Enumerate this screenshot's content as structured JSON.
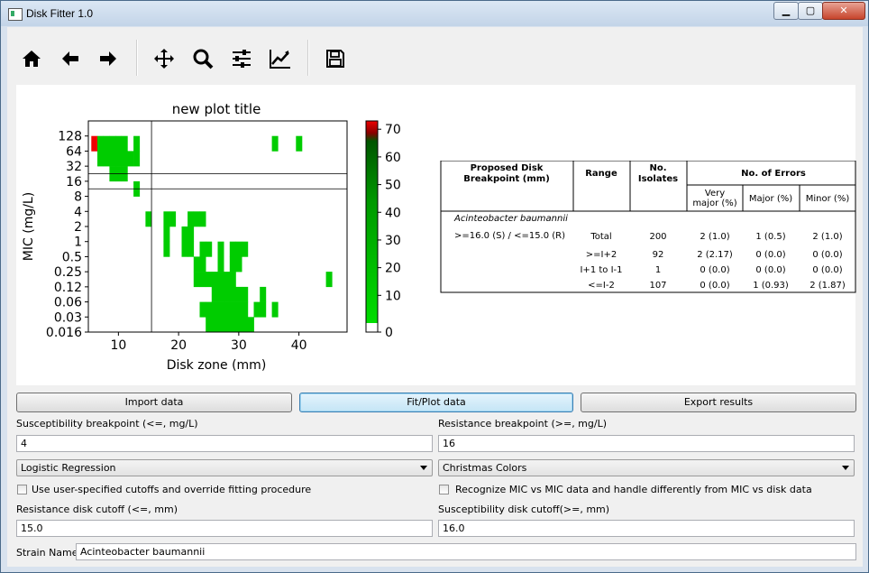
{
  "window": {
    "title": "Disk Fitter 1.0",
    "min_icon": "minimize-icon",
    "max_icon": "maximize-icon",
    "close_icon": "close-icon"
  },
  "toolbar": {
    "icons": [
      "home-icon",
      "back-arrow-icon",
      "forward-arrow-icon",
      "pan-icon",
      "zoom-icon",
      "configure-subplots-icon",
      "edit-axis-icon",
      "save-icon"
    ]
  },
  "plot": {
    "title": "new plot title",
    "xlabel": "Disk zone (mm)",
    "ylabel": "MIC (mg/L)",
    "ytick_labels": [
      "0.016",
      "0.03",
      "0.06",
      "0.12",
      "0.25",
      "0.5",
      "1",
      "2",
      "4",
      "8",
      "16",
      "32",
      "64",
      "128"
    ],
    "xtick_labels": [
      "10",
      "20",
      "30",
      "40"
    ],
    "colorbar_ticks": [
      "0",
      "10",
      "20",
      "30",
      "40",
      "50",
      "60",
      "70"
    ]
  },
  "chart_data": {
    "type": "heatmap",
    "title": "new plot title",
    "xlabel": "Disk zone (mm)",
    "ylabel": "MIC (mg/L)",
    "xlim": [
      5,
      48
    ],
    "y_levels": [
      "0.016",
      "0.03",
      "0.06",
      "0.12",
      "0.25",
      "0.5",
      "1",
      "2",
      "4",
      "8",
      "16",
      "32",
      "64",
      "128"
    ],
    "vlines": [
      16
    ],
    "hlines": [
      8,
      16
    ],
    "colorbar_range": [
      0,
      73
    ],
    "colors": {
      "low": "#00cc00",
      "mid": "#00aa00",
      "high": "#cc0000",
      "max": "#ee0000"
    },
    "cells": [
      {
        "x": 6,
        "y": "64",
        "v": 73
      },
      {
        "x": 7,
        "y": "64",
        "v": 4
      },
      {
        "x": 8,
        "y": "64",
        "v": 4
      },
      {
        "x": 9,
        "y": "64",
        "v": 4
      },
      {
        "x": 10,
        "y": "64",
        "v": 4
      },
      {
        "x": 11,
        "y": "64",
        "v": 4
      },
      {
        "x": 13,
        "y": "64",
        "v": 4
      },
      {
        "x": 7,
        "y": "32",
        "v": 4
      },
      {
        "x": 8,
        "y": "32",
        "v": 4
      },
      {
        "x": 9,
        "y": "32",
        "v": 4
      },
      {
        "x": 10,
        "y": "32",
        "v": 4
      },
      {
        "x": 11,
        "y": "32",
        "v": 4
      },
      {
        "x": 12,
        "y": "32",
        "v": 4
      },
      {
        "x": 13,
        "y": "32",
        "v": 4
      },
      {
        "x": 9,
        "y": "16",
        "v": 4
      },
      {
        "x": 10,
        "y": "16",
        "v": 4
      },
      {
        "x": 11,
        "y": "16",
        "v": 4
      },
      {
        "x": 13,
        "y": "8",
        "v": 4
      },
      {
        "x": 15,
        "y": "2",
        "v": 4
      },
      {
        "x": 18,
        "y": "2",
        "v": 4
      },
      {
        "x": 19,
        "y": "2",
        "v": 4
      },
      {
        "x": 22,
        "y": "2",
        "v": 4
      },
      {
        "x": 23,
        "y": "2",
        "v": 4
      },
      {
        "x": 24,
        "y": "2",
        "v": 4
      },
      {
        "x": 18,
        "y": "1",
        "v": 4
      },
      {
        "x": 21,
        "y": "1",
        "v": 4
      },
      {
        "x": 22,
        "y": "1",
        "v": 4
      },
      {
        "x": 18,
        "y": "0.5",
        "v": 4
      },
      {
        "x": 21,
        "y": "0.5",
        "v": 4
      },
      {
        "x": 22,
        "y": "0.5",
        "v": 4
      },
      {
        "x": 24,
        "y": "0.5",
        "v": 4
      },
      {
        "x": 25,
        "y": "0.5",
        "v": 4
      },
      {
        "x": 27,
        "y": "0.5",
        "v": 4
      },
      {
        "x": 29,
        "y": "0.5",
        "v": 4
      },
      {
        "x": 30,
        "y": "0.5",
        "v": 4
      },
      {
        "x": 31,
        "y": "0.5",
        "v": 4
      },
      {
        "x": 23,
        "y": "0.25",
        "v": 4
      },
      {
        "x": 24,
        "y": "0.25",
        "v": 4
      },
      {
        "x": 27,
        "y": "0.25",
        "v": 4
      },
      {
        "x": 29,
        "y": "0.25",
        "v": 4
      },
      {
        "x": 30,
        "y": "0.25",
        "v": 4
      },
      {
        "x": 23,
        "y": "0.12",
        "v": 4
      },
      {
        "x": 24,
        "y": "0.12",
        "v": 4
      },
      {
        "x": 25,
        "y": "0.12",
        "v": 4
      },
      {
        "x": 26,
        "y": "0.12",
        "v": 4
      },
      {
        "x": 27,
        "y": "0.12",
        "v": 4
      },
      {
        "x": 28,
        "y": "0.12",
        "v": 4
      },
      {
        "x": 29,
        "y": "0.12",
        "v": 4
      },
      {
        "x": 26,
        "y": "0.06",
        "v": 4
      },
      {
        "x": 27,
        "y": "0.06",
        "v": 4
      },
      {
        "x": 28,
        "y": "0.06",
        "v": 4
      },
      {
        "x": 29,
        "y": "0.06",
        "v": 4
      },
      {
        "x": 30,
        "y": "0.06",
        "v": 4
      },
      {
        "x": 31,
        "y": "0.06",
        "v": 4
      },
      {
        "x": 24,
        "y": "0.03",
        "v": 4
      },
      {
        "x": 25,
        "y": "0.03",
        "v": 4
      },
      {
        "x": 26,
        "y": "0.03",
        "v": 4
      },
      {
        "x": 27,
        "y": "0.03",
        "v": 4
      },
      {
        "x": 28,
        "y": "0.03",
        "v": 4
      },
      {
        "x": 29,
        "y": "0.03",
        "v": 4
      },
      {
        "x": 30,
        "y": "0.03",
        "v": 4
      },
      {
        "x": 31,
        "y": "0.03",
        "v": 4
      },
      {
        "x": 25,
        "y": "0.016",
        "v": 4
      },
      {
        "x": 26,
        "y": "0.016",
        "v": 4
      },
      {
        "x": 27,
        "y": "0.016",
        "v": 4
      },
      {
        "x": 28,
        "y": "0.016",
        "v": 4
      },
      {
        "x": 29,
        "y": "0.016",
        "v": 4
      },
      {
        "x": 30,
        "y": "0.016",
        "v": 4
      },
      {
        "x": 31,
        "y": "0.016",
        "v": 4
      },
      {
        "x": 32,
        "y": "0.016",
        "v": 4
      }
    ],
    "extra_cells": [
      {
        "x": 36,
        "y": "64",
        "v": 4
      },
      {
        "x": 40,
        "y": "64",
        "v": 4
      },
      {
        "x": 45,
        "y": "0.12",
        "v": 4
      },
      {
        "x": 34,
        "y": "0.06",
        "v": 4
      },
      {
        "x": 33,
        "y": "0.03",
        "v": 4
      },
      {
        "x": 34,
        "y": "0.03",
        "v": 4
      },
      {
        "x": 36,
        "y": "0.03",
        "v": 4
      }
    ]
  },
  "table": {
    "headers": {
      "breakpoint": "Proposed Disk Breakpoint (mm)",
      "range": "Range",
      "isolates": "No. Isolates",
      "errors": "No. of Errors",
      "very_major": "Very major (%)",
      "major": "Major (%)",
      "minor": "Minor (%)"
    },
    "organism": "Acinteobacter baumannii",
    "breakpoint_text": ">=16.0 (S) / <=15.0 (R)",
    "rows": [
      {
        "range": "Total",
        "isolates": "200",
        "very_major": "2 (1.0)",
        "major": "1 (0.5)",
        "minor": "2 (1.0)"
      },
      {
        "range": ">=I+2",
        "isolates": "92",
        "very_major": "2 (2.17)",
        "major": "0 (0.0)",
        "minor": "0 (0.0)"
      },
      {
        "range": "I+1 to I-1",
        "isolates": "1",
        "very_major": "0 (0.0)",
        "major": "0 (0.0)",
        "minor": "0 (0.0)"
      },
      {
        "range": "<=I-2",
        "isolates": "107",
        "very_major": "0 (0.0)",
        "major": "1 (0.93)",
        "minor": "2 (1.87)"
      }
    ]
  },
  "buttons": {
    "import": "Import data",
    "fit": "Fit/Plot data",
    "export": "Export results"
  },
  "form": {
    "susc_bp_label": "Susceptibility breakpoint (<=, mg/L)",
    "susc_bp_value": "4",
    "res_bp_label": "Resistance breakpoint (>=, mg/L)",
    "res_bp_value": "16",
    "method_value": "Logistic Regression",
    "colormap_value": "Christmas Colors",
    "override_label": "Use user-specified cutoffs and override fitting procedure",
    "mic_vs_mic_label": "Recognize MIC vs MIC data and handle differently from MIC vs disk data",
    "res_disk_label": "Resistance disk cutoff (<=, mm)",
    "res_disk_value": "15.0",
    "susc_disk_label": "Susceptibility disk cutoff(>=, mm)",
    "susc_disk_value": "16.0",
    "strain_label": "Strain Name:",
    "strain_value": "Acinteobacter baumannii"
  }
}
